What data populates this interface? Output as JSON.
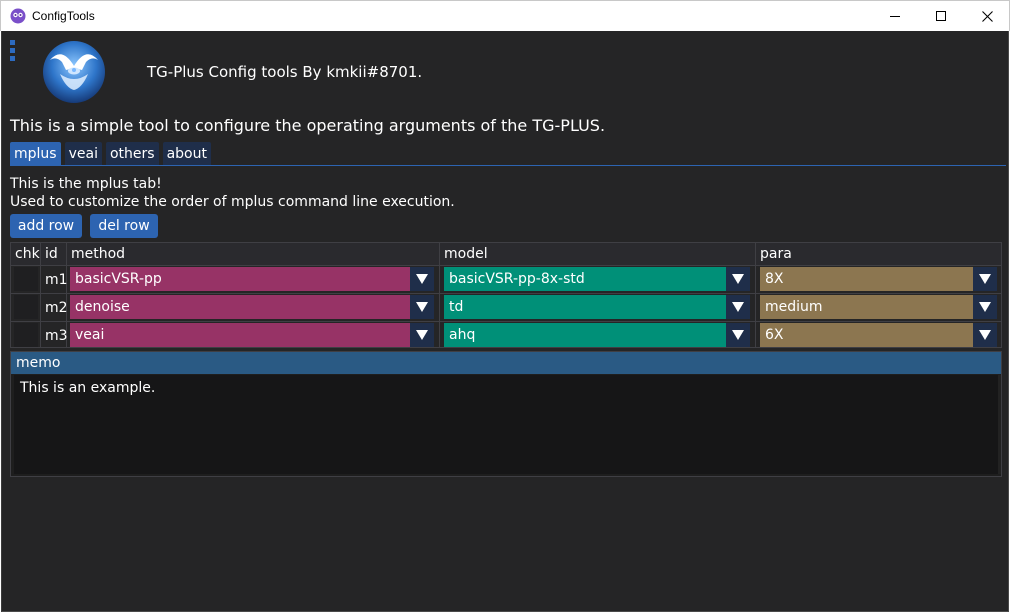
{
  "window": {
    "title": "ConfigTools",
    "controls": {
      "minimize": "minimize",
      "maximize": "maximize",
      "close": "close"
    }
  },
  "header": {
    "title": "TG-Plus Config tools By kmkii#8701.",
    "description": "This is a simple tool to configure the operating arguments of the TG-PLUS."
  },
  "tabs": [
    {
      "label": "mplus",
      "active": true
    },
    {
      "label": "veai",
      "active": false
    },
    {
      "label": "others",
      "active": false
    },
    {
      "label": "about",
      "active": false
    }
  ],
  "mplus": {
    "intro_line1": "This is the mplus tab!",
    "intro_line2": "Used to customize the order of mplus command line execution.",
    "add_row_label": "add row",
    "del_row_label": "del row",
    "columns": [
      "chk",
      "id",
      "method",
      "model",
      "para"
    ],
    "rows": [
      {
        "chk": false,
        "id": "m1",
        "method": "basicVSR-pp",
        "model": "basicVSR-pp-8x-std",
        "para": "8X"
      },
      {
        "chk": false,
        "id": "m2",
        "method": "denoise",
        "model": "td",
        "para": "medium"
      },
      {
        "chk": false,
        "id": "m3",
        "method": "veai",
        "model": "ahq",
        "para": "6X"
      }
    ]
  },
  "memo": {
    "label": "memo",
    "text": "This is an example."
  },
  "colors": {
    "background": "#252526",
    "accent": "#2d64b1",
    "method_combo": "#973366",
    "model_combo": "#009078",
    "para_combo": "#8c7650",
    "memo_header": "#2a5a84"
  }
}
